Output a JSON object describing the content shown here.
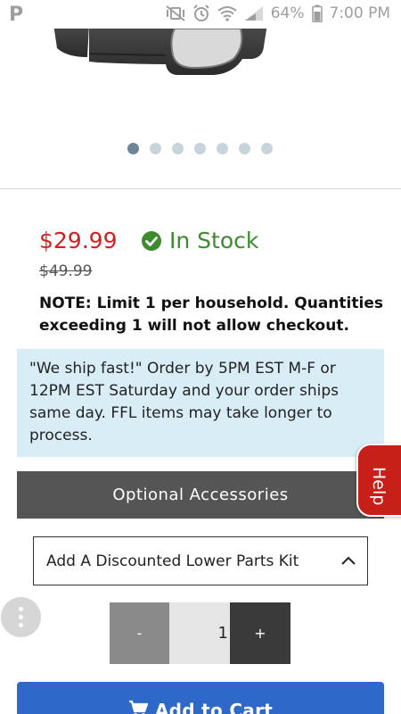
{
  "status_bar": {
    "app_badge": "P",
    "battery_percent": "64%",
    "time": "7:00 PM"
  },
  "carousel": {
    "total_slides": 7,
    "active_index": 0
  },
  "product": {
    "price": "$29.99",
    "stock_status": "In Stock",
    "old_price": "$49.99",
    "note": "NOTE: Limit 1 per household. Quantities exceeding 1 will not allow checkout."
  },
  "shipping_notice": "\"We ship fast!\" Order by 5PM EST M-F or 12PM EST Saturday and your order ships same day. FFL items may take longer to process.",
  "accessories": {
    "header": "Optional Accessories",
    "select_value": "Add A Discounted Lower Parts Kit"
  },
  "help_label": "Help",
  "quantity": {
    "minus_label": "-",
    "value": "1",
    "plus_label": "+"
  },
  "cart_button_label": "Add to Cart",
  "colors": {
    "price": "#d0201f",
    "in_stock": "#3d8b2e",
    "notice_bg": "#d9edf7",
    "accessory_bar": "#555555",
    "help_tab": "#c62019",
    "cart_button": "#2e68c8"
  },
  "icons": {
    "stock": "check-circle-icon",
    "select": "chevron-up-icon",
    "cart": "shopping-cart-icon",
    "menu": "more-vertical-icon"
  }
}
